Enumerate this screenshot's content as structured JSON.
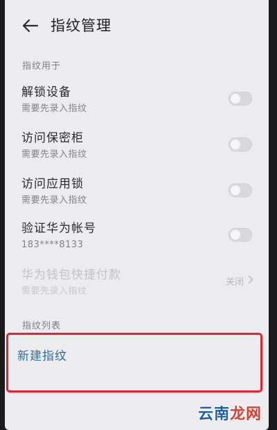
{
  "header": {
    "back_icon": "arrow-left-icon",
    "title": "指纹管理"
  },
  "sections": {
    "usage_label": "指纹用于",
    "list_label": "指纹列表"
  },
  "usage_items": [
    {
      "title": "解锁设备",
      "subtitle": "需要先录入指纹",
      "enabled": false
    },
    {
      "title": "访问保密柜",
      "subtitle": "需要先录入指纹",
      "enabled": false
    },
    {
      "title": "访问应用锁",
      "subtitle": "需要先录入指纹",
      "enabled": false
    },
    {
      "title": "验证华为帐号",
      "subtitle": "183****8133",
      "enabled": false
    },
    {
      "title": "华为钱包快捷付款",
      "subtitle": "需要先录入指纹",
      "value": "关闭",
      "chevron_icon": "chevron-right-icon"
    }
  ],
  "new_fingerprint": {
    "label": "新建指纹"
  },
  "annotation": {
    "color": "#e8222e"
  },
  "watermark": {
    "text_a": "云南",
    "text_b": "龙网"
  }
}
